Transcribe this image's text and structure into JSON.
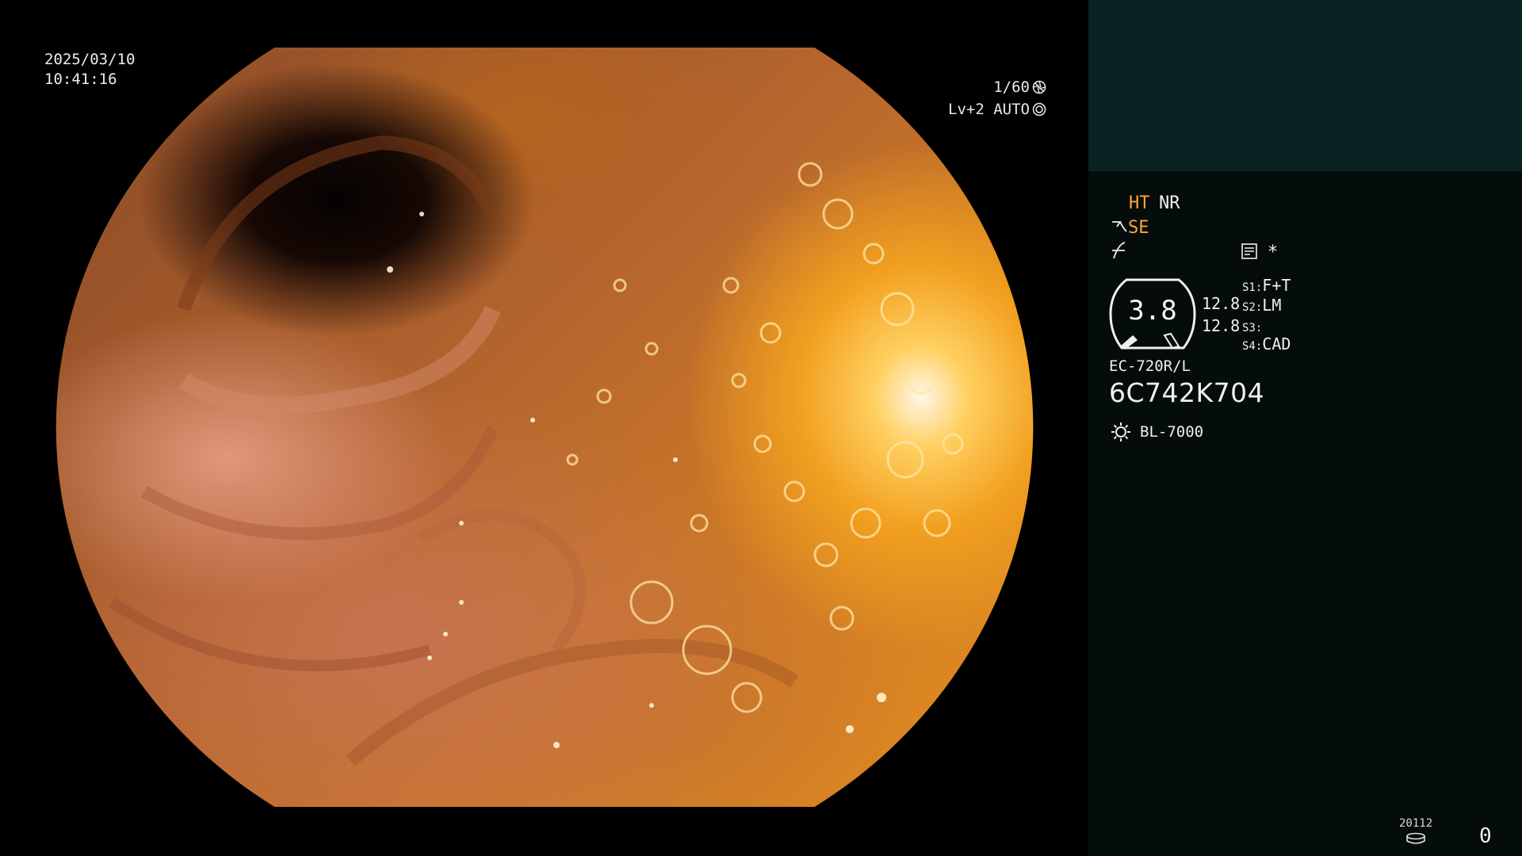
{
  "header": {
    "date": "2025/03/10",
    "time": "10:41:16",
    "shutter": "1/60",
    "level": "Lv+2 AUTO"
  },
  "panel": {
    "ht": "HT",
    "nr": "NR",
    "se": "SE",
    "asterisk": "*",
    "gauge_value": "3.8",
    "gauge_side_1": "12.8",
    "gauge_side_2": "12.8",
    "switches": [
      {
        "key": "S1:",
        "value": "F+T"
      },
      {
        "key": "S2:",
        "value": "LM"
      },
      {
        "key": "S3:",
        "value": ""
      },
      {
        "key": "S4:",
        "value": "CAD"
      }
    ],
    "scope_model": "EC-720R/L",
    "serial": "6C742K704",
    "lamp": "BL-7000",
    "counter_number": "20112",
    "counter_value": "0"
  },
  "icons": {
    "shutter": "aperture-icon",
    "level": "auto-iris-icon",
    "se": "scope-se-icon",
    "f": "f-curve-icon",
    "memo": "memo-icon",
    "lamp": "sun-lamp-icon",
    "disk": "disk-icon"
  },
  "colors": {
    "accent_orange": "#ffa53a",
    "panel_bg": "#050c0c",
    "thumb_bg": "#0b2222"
  }
}
